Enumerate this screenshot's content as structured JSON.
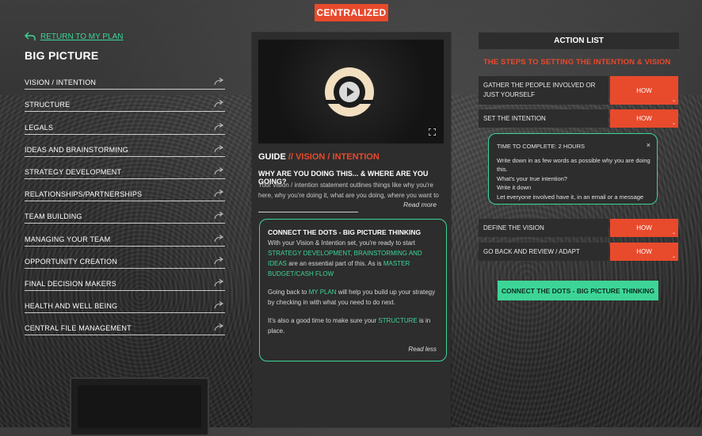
{
  "brand": "CENTRALIZED",
  "back_link": "RETURN TO MY PLAN",
  "section_title": "BIG PICTURE",
  "nav": [
    "VISION / INTENTION",
    "STRUCTURE",
    "LEGALS",
    "IDEAS AND BRAINSTORMING",
    "STRATEGY DEVELOPMENT",
    "RELATIONSHIPS/PARTNERSHIPS",
    "TEAM BUILDING",
    "MANAGING YOUR TEAM",
    "OPPORTUNITY CREATION",
    "FINAL DECISION MAKERS",
    "HEALTH AND WELL BEING",
    "CENTRAL FILE MANAGEMENT"
  ],
  "guide": {
    "label": "GUIDE",
    "sep": " // ",
    "topic": "VISION / INTENTION",
    "question": "WHY ARE YOU DOING THIS... & WHERE ARE YOU GOING?",
    "body": "Your vision / intention statement outlines things like why you're here, why you're doing it, what are you doing, where you want to",
    "read_more": "Read more"
  },
  "dots": {
    "title": "CONNECT THE DOTS - BIG PICTURE THINKING",
    "p1_a": "With your Vision & Intention set, you're ready to start",
    "p1_link1": "STRATEGY DEVELOPMENT, BRAINSTORMING AND IDEAS",
    "p1_b": "are an essential part of this. As is",
    "p1_link2": "MASTER BUDGET/CASH FLOW",
    "p2_a": "Going back to",
    "p2_link": "MY PLAN",
    "p2_b": "will help you build up your strategy by checking in with what you need to do next.",
    "p3_a": "It's also a good time to make sure your",
    "p3_link": "STRUCTURE",
    "p3_b": "is in place.",
    "read_less": "Read less"
  },
  "action_list": {
    "title": "ACTION LIST",
    "steps_title": "THE STEPS TO SETTING THE INTENTION & VISION",
    "how_label": "HOW",
    "items": [
      "GATHER THE PEOPLE INVOLVED OR JUST YOURSELF",
      "SET THE INTENTION",
      "DEFINE THE VISION",
      "GO BACK AND REVIEW / ADAPT"
    ],
    "tip": {
      "time": "TIME TO COMPLETE: 2 HOURS",
      "lines": [
        "Write down in as few words as possible why you are doing this.",
        "What's your true intention?",
        "Write it down",
        "Let everyone involved have it, in an email or a message"
      ],
      "close": "×"
    },
    "cta": "CONNECT THE DOTS - BIG PICTURE THINKING"
  },
  "colors": {
    "accent": "#e84a2c",
    "green": "#3dd597",
    "panel": "#2d2d2d"
  }
}
